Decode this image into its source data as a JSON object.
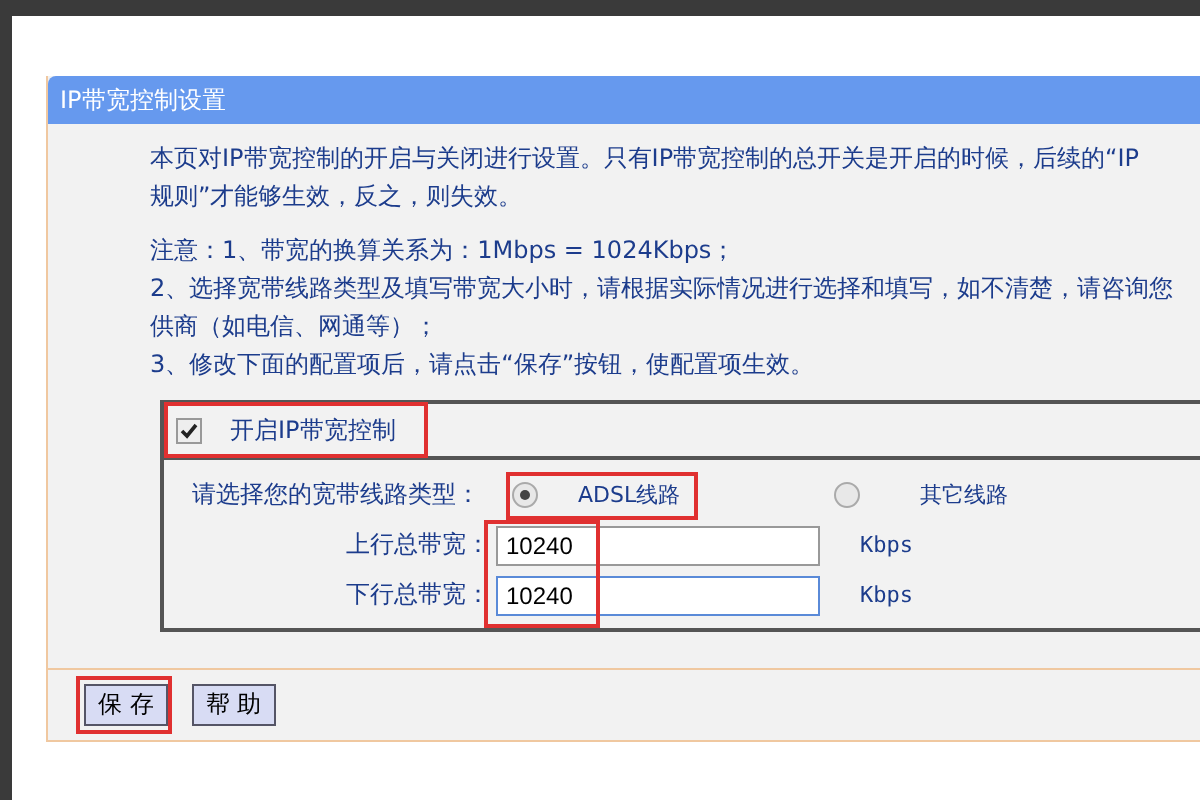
{
  "panel": {
    "title": "IP带宽控制设置",
    "intro": [
      "本页对IP带宽控制的开启与关闭进行设置。只有IP带宽控制的总开关是开启的时候，后续的“IP",
      "规则”才能够生效，反之，则失效。"
    ],
    "notes": [
      "注意：1、带宽的换算关系为：1Mbps = 1024Kbps；",
      "2、选择宽带线路类型及填写带宽大小时，请根据实际情况进行选择和填写，如不清楚，请咨询您",
      "供商（如电信、网通等）；",
      "3、修改下面的配置项后，请点击“保存”按钮，使配置项生效。"
    ]
  },
  "enable": {
    "label": "开启IP带宽控制",
    "checked": true
  },
  "line_type": {
    "label": "请选择您的宽带线路类型：",
    "options": [
      {
        "label": "ADSL线路",
        "selected": true
      },
      {
        "label": "其它线路",
        "selected": false
      }
    ]
  },
  "bandwidth": [
    {
      "label": "上行总带宽：",
      "value": "10240",
      "unit": "Kbps"
    },
    {
      "label": "下行总带宽：",
      "value": "10240",
      "unit": "Kbps"
    }
  ],
  "buttons": [
    {
      "label": "保 存"
    },
    {
      "label": "帮 助"
    }
  ]
}
